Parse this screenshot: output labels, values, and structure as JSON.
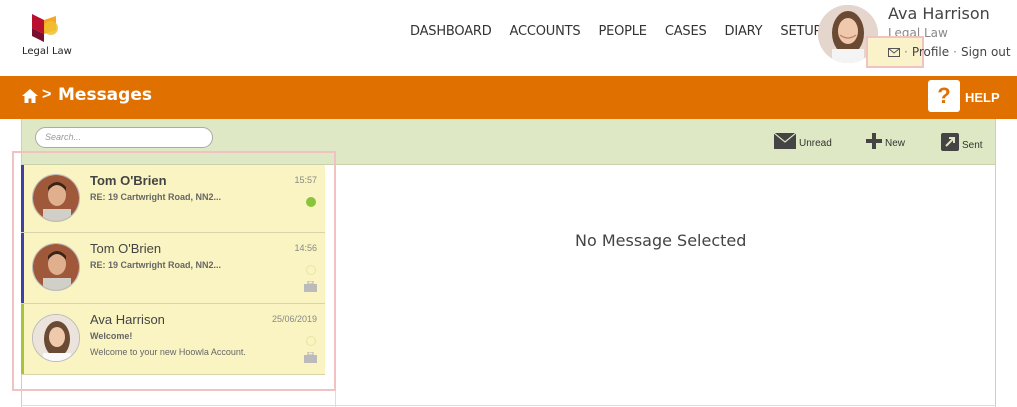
{
  "app": {
    "logo_text": "Legal Law",
    "colors": {
      "accent": "#e07000",
      "toolbar": "#dfe8c4",
      "list_bg": "#faf4c2",
      "online": "#8ac43a",
      "unread_bar": "#4040a0"
    }
  },
  "nav": {
    "items": [
      "DASHBOARD",
      "ACCOUNTS",
      "PEOPLE",
      "CASES",
      "DIARY",
      "SETUP"
    ]
  },
  "user": {
    "name": "Ava Harrison",
    "org": "Legal Law",
    "profile_label": "Profile",
    "separator": "·",
    "signout_label": "Sign out"
  },
  "titlebar": {
    "breadcrumb_sep": ">",
    "title": "Messages",
    "help_icon": "?",
    "help_label": "HELP"
  },
  "toolbar": {
    "search_placeholder": "Search...",
    "unread_label": "Unread",
    "new_label": "New",
    "sent_label": "Sent"
  },
  "messages": [
    {
      "name": "Tom O'Brien",
      "subject": "RE: 19 Cartwright Road, NN2...",
      "preview": "",
      "time": "15:57",
      "unread": true,
      "status": "online"
    },
    {
      "name": "Tom O'Brien",
      "subject": "RE: 19 Cartwright Road, NN2...",
      "preview": "",
      "time": "14:56",
      "unread": false,
      "status": "offline"
    },
    {
      "name": "Ava Harrison",
      "subject": "Welcome!",
      "preview": "Welcome to your new Hoowla Account.",
      "time": "25/06/2019",
      "unread": false,
      "status": "offline"
    }
  ],
  "detail": {
    "empty_text": "No Message Selected"
  }
}
